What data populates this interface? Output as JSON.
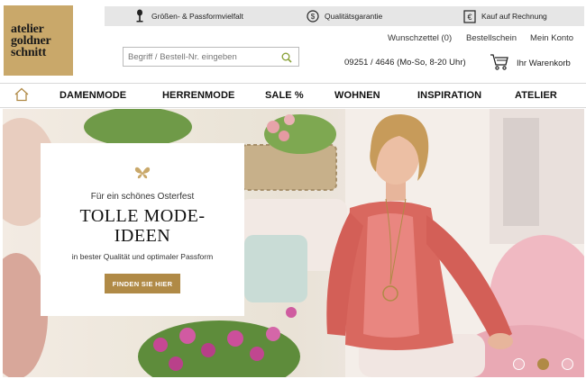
{
  "logo": {
    "line1": "atelier",
    "line2": "goldner",
    "line3": "schnitt"
  },
  "usp": [
    {
      "icon": "dress-form-icon",
      "text": "Größen- & Passformvielfalt"
    },
    {
      "icon": "quality-seal-icon",
      "text": "Qualitätsgarantie"
    },
    {
      "icon": "euro-invoice-icon",
      "text": "Kauf auf Rechnung"
    }
  ],
  "search": {
    "placeholder": "Begriff / Bestell-Nr. eingeben"
  },
  "account": {
    "wishlist": "Wunschzettel (0)",
    "order_form": "Bestellschein",
    "my_account": "Mein Konto",
    "phone": "09251 / 4646 (Mo-So, 8-20 Uhr)",
    "cart": "Ihr Warenkorb"
  },
  "nav": {
    "items": [
      "DAMENMODE",
      "HERRENMODE",
      "SALE %",
      "WOHNEN",
      "INSPIRATION",
      "ATELIER"
    ]
  },
  "hero": {
    "subtitle": "Für ein schönes Osterfest",
    "title_line1": "TOLLE MODE-",
    "title_line2": "IDEEN",
    "description": "in bester Qualität und optimaler Passform",
    "cta": "FINDEN SIE HIER",
    "slides_total": 3,
    "slide_active": 2
  },
  "colors": {
    "gold": "#b08a46",
    "logo_bg": "#c9a86a",
    "usp_bar": "#e6e6e6",
    "cardigan": "#d9685f"
  }
}
